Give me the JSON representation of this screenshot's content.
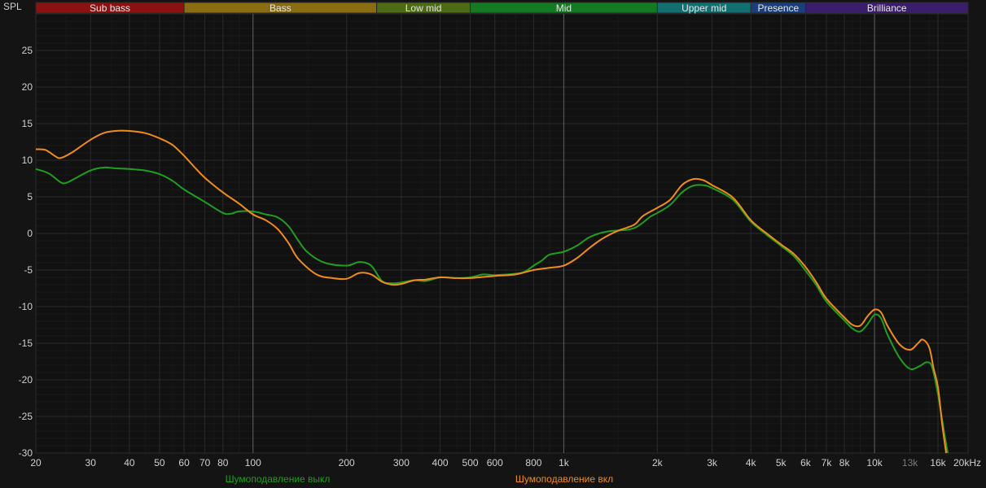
{
  "chart_data": {
    "type": "line",
    "ylabel": "SPL",
    "xunit": "kHz",
    "xscale": "log",
    "xlim": [
      20,
      20000
    ],
    "ylim": [
      -30,
      30
    ],
    "yticks": [
      -30,
      -25,
      -20,
      -15,
      -10,
      -5,
      0,
      5,
      10,
      15,
      20,
      25
    ],
    "xticks": [
      {
        "value": 20,
        "label": "20"
      },
      {
        "value": 30,
        "label": "30"
      },
      {
        "value": 40,
        "label": "40"
      },
      {
        "value": 50,
        "label": "50"
      },
      {
        "value": 60,
        "label": "60"
      },
      {
        "value": 70,
        "label": "70"
      },
      {
        "value": 80,
        "label": "80"
      },
      {
        "value": 100,
        "label": "100"
      },
      {
        "value": 200,
        "label": "200"
      },
      {
        "value": 300,
        "label": "300"
      },
      {
        "value": 400,
        "label": "400"
      },
      {
        "value": 500,
        "label": "500"
      },
      {
        "value": 600,
        "label": "600"
      },
      {
        "value": 800,
        "label": "800"
      },
      {
        "value": 1000,
        "label": "1k"
      },
      {
        "value": 2000,
        "label": "2k"
      },
      {
        "value": 3000,
        "label": "3k"
      },
      {
        "value": 4000,
        "label": "4k"
      },
      {
        "value": 5000,
        "label": "5k"
      },
      {
        "value": 6000,
        "label": "6k"
      },
      {
        "value": 7000,
        "label": "7k"
      },
      {
        "value": 8000,
        "label": "8k"
      },
      {
        "value": 10000,
        "label": "10k"
      },
      {
        "value": 13000,
        "label": "13k",
        "dim": true
      },
      {
        "value": 16000,
        "label": "16k"
      },
      {
        "value": 20000,
        "label": "20kHz"
      }
    ],
    "major_x": [
      100,
      1000,
      10000
    ],
    "bands": [
      {
        "name": "Sub bass",
        "from": 20,
        "to": 60,
        "color": "#8c1212"
      },
      {
        "name": "Bass",
        "from": 60,
        "to": 250,
        "color": "#8a6d12"
      },
      {
        "name": "Low mid",
        "from": 250,
        "to": 500,
        "color": "#4d6b12"
      },
      {
        "name": "Mid",
        "from": 500,
        "to": 2000,
        "color": "#157a24"
      },
      {
        "name": "Upper mid",
        "from": 2000,
        "to": 4000,
        "color": "#137070"
      },
      {
        "name": "Presence",
        "from": 4000,
        "to": 6000,
        "color": "#1a3f7a"
      },
      {
        "name": "Brilliance",
        "from": 6000,
        "to": 20000,
        "color": "#3a1d6b"
      }
    ],
    "series": [
      {
        "name": "Шумоподавление выкл",
        "color": "#1f9e1f",
        "points": [
          [
            20,
            8.8
          ],
          [
            22,
            8.2
          ],
          [
            24,
            7.0
          ],
          [
            25,
            6.9
          ],
          [
            27,
            7.6
          ],
          [
            30,
            8.6
          ],
          [
            33,
            9.0
          ],
          [
            36,
            8.9
          ],
          [
            40,
            8.8
          ],
          [
            45,
            8.6
          ],
          [
            50,
            8.1
          ],
          [
            55,
            7.2
          ],
          [
            60,
            6.0
          ],
          [
            70,
            4.3
          ],
          [
            80,
            2.8
          ],
          [
            85,
            2.7
          ],
          [
            90,
            3.0
          ],
          [
            100,
            3.0
          ],
          [
            110,
            2.6
          ],
          [
            120,
            2.2
          ],
          [
            130,
            1.0
          ],
          [
            140,
            -1.0
          ],
          [
            150,
            -2.6
          ],
          [
            170,
            -4.0
          ],
          [
            200,
            -4.4
          ],
          [
            220,
            -3.9
          ],
          [
            240,
            -4.4
          ],
          [
            260,
            -6.5
          ],
          [
            280,
            -6.8
          ],
          [
            300,
            -6.7
          ],
          [
            330,
            -6.4
          ],
          [
            360,
            -6.5
          ],
          [
            400,
            -6.0
          ],
          [
            450,
            -6.1
          ],
          [
            500,
            -6.0
          ],
          [
            550,
            -5.6
          ],
          [
            600,
            -5.7
          ],
          [
            700,
            -5.5
          ],
          [
            750,
            -5.2
          ],
          [
            800,
            -4.4
          ],
          [
            850,
            -3.7
          ],
          [
            900,
            -2.9
          ],
          [
            1000,
            -2.5
          ],
          [
            1100,
            -1.7
          ],
          [
            1200,
            -0.6
          ],
          [
            1300,
            0.0
          ],
          [
            1400,
            0.3
          ],
          [
            1500,
            0.4
          ],
          [
            1600,
            0.5
          ],
          [
            1700,
            0.8
          ],
          [
            1800,
            1.5
          ],
          [
            1900,
            2.3
          ],
          [
            2000,
            2.8
          ],
          [
            2200,
            3.9
          ],
          [
            2400,
            5.6
          ],
          [
            2600,
            6.5
          ],
          [
            2800,
            6.6
          ],
          [
            3000,
            6.2
          ],
          [
            3500,
            4.6
          ],
          [
            4000,
            1.6
          ],
          [
            4500,
            -0.2
          ],
          [
            5000,
            -1.7
          ],
          [
            5500,
            -3.1
          ],
          [
            6000,
            -5.1
          ],
          [
            6500,
            -7.1
          ],
          [
            7000,
            -9.3
          ],
          [
            8000,
            -11.9
          ],
          [
            8500,
            -13.0
          ],
          [
            9000,
            -13.4
          ],
          [
            9500,
            -12.4
          ],
          [
            10000,
            -11.1
          ],
          [
            10500,
            -11.6
          ],
          [
            11000,
            -13.8
          ],
          [
            12000,
            -16.9
          ],
          [
            13000,
            -18.5
          ],
          [
            14000,
            -18.1
          ],
          [
            14700,
            -17.6
          ],
          [
            15300,
            -18.2
          ],
          [
            16000,
            -22.0
          ],
          [
            16800,
            -27.5
          ],
          [
            17200,
            -30.0
          ]
        ]
      },
      {
        "name": "Шумоподавление вкл",
        "color": "#f08c1c",
        "points": [
          [
            20,
            11.5
          ],
          [
            21.5,
            11.4
          ],
          [
            23,
            10.6
          ],
          [
            24,
            10.3
          ],
          [
            26,
            11.0
          ],
          [
            30,
            12.8
          ],
          [
            33,
            13.7
          ],
          [
            36,
            14.0
          ],
          [
            40,
            14.0
          ],
          [
            45,
            13.7
          ],
          [
            50,
            13.0
          ],
          [
            55,
            12.1
          ],
          [
            60,
            10.6
          ],
          [
            65,
            9.0
          ],
          [
            70,
            7.6
          ],
          [
            80,
            5.6
          ],
          [
            90,
            4.1
          ],
          [
            100,
            2.6
          ],
          [
            110,
            1.8
          ],
          [
            120,
            0.6
          ],
          [
            130,
            -1.3
          ],
          [
            140,
            -3.5
          ],
          [
            160,
            -5.6
          ],
          [
            180,
            -6.1
          ],
          [
            200,
            -6.2
          ],
          [
            220,
            -5.4
          ],
          [
            240,
            -5.6
          ],
          [
            260,
            -6.6
          ],
          [
            280,
            -7.0
          ],
          [
            300,
            -6.9
          ],
          [
            330,
            -6.4
          ],
          [
            360,
            -6.3
          ],
          [
            400,
            -6.0
          ],
          [
            450,
            -6.1
          ],
          [
            500,
            -6.1
          ],
          [
            600,
            -5.8
          ],
          [
            700,
            -5.6
          ],
          [
            800,
            -5.0
          ],
          [
            900,
            -4.7
          ],
          [
            1000,
            -4.4
          ],
          [
            1100,
            -3.4
          ],
          [
            1200,
            -2.1
          ],
          [
            1300,
            -1.0
          ],
          [
            1400,
            -0.2
          ],
          [
            1500,
            0.4
          ],
          [
            1600,
            0.8
          ],
          [
            1700,
            1.3
          ],
          [
            1800,
            2.4
          ],
          [
            2000,
            3.5
          ],
          [
            2200,
            4.6
          ],
          [
            2400,
            6.6
          ],
          [
            2600,
            7.4
          ],
          [
            2800,
            7.3
          ],
          [
            3000,
            6.6
          ],
          [
            3500,
            4.9
          ],
          [
            4000,
            1.8
          ],
          [
            4500,
            0.0
          ],
          [
            5000,
            -1.5
          ],
          [
            5500,
            -2.8
          ],
          [
            6000,
            -4.6
          ],
          [
            6500,
            -6.7
          ],
          [
            7000,
            -8.9
          ],
          [
            8000,
            -11.5
          ],
          [
            8500,
            -12.5
          ],
          [
            9000,
            -12.6
          ],
          [
            9500,
            -11.3
          ],
          [
            10000,
            -10.4
          ],
          [
            10500,
            -10.8
          ],
          [
            11000,
            -12.6
          ],
          [
            12000,
            -15.1
          ],
          [
            13000,
            -15.9
          ],
          [
            13800,
            -15.0
          ],
          [
            14300,
            -14.5
          ],
          [
            15000,
            -15.6
          ],
          [
            15500,
            -18.5
          ],
          [
            16000,
            -21.0
          ],
          [
            16500,
            -26.0
          ],
          [
            17000,
            -30.0
          ]
        ]
      }
    ]
  }
}
